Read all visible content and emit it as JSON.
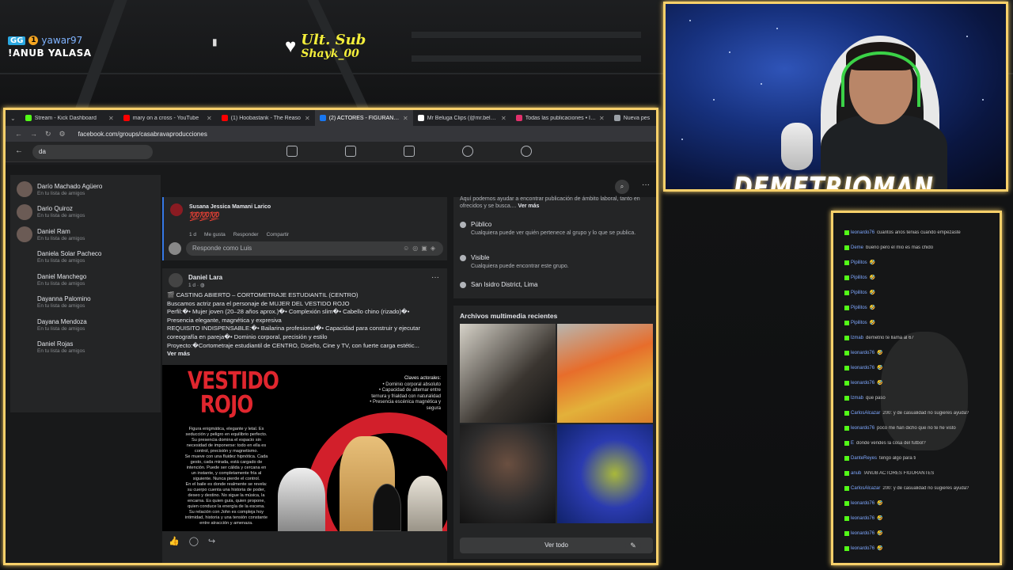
{
  "overlay": {
    "viewer_badge": "GG",
    "viewer_count_badge": "1",
    "viewer_name": "yawar97",
    "command_text": "!ANUB YALASA",
    "sub_label": "Ult. Sub",
    "sub_name": "Shayk_00",
    "streamer_name": "DEMETRIOMAN"
  },
  "browser": {
    "tabs": [
      {
        "label": "Stream - Kick Dashboard",
        "color": "#53fc18",
        "active": false
      },
      {
        "label": "mary on a cross - YouTube",
        "color": "#ff0000",
        "active": false
      },
      {
        "label": "(1) Hoobastank - The Reaso",
        "color": "#ff0000",
        "active": false
      },
      {
        "label": "(2) ACTORES - FIGURANTES - E",
        "color": "#1877f2",
        "active": true
      },
      {
        "label": "Mr Beluga Clips (@mr.beluga.c",
        "color": "#ffffff",
        "active": false
      },
      {
        "label": "Todas las publicaciones • Insta",
        "color": "#e1306c",
        "active": false
      },
      {
        "label": "Nueva pes",
        "color": "#9aa0a6",
        "active": false
      }
    ],
    "url": "facebook.com/groups/casabravaproducciones"
  },
  "search": {
    "query": "da",
    "results": [
      {
        "name": "Darío Machado Agüero",
        "sub": "En tu lista de amigos",
        "has_avatar": true
      },
      {
        "name": "Dario Quiroz",
        "sub": "En tu lista de amigos",
        "has_avatar": true
      },
      {
        "name": "Daniel Ram",
        "sub": "En tu lista de amigos",
        "has_avatar": true
      },
      {
        "name": "Daniela Solar Pacheco",
        "sub": "En tu lista de amigos",
        "has_avatar": false
      },
      {
        "name": "Daniel Manchego",
        "sub": "En tu lista de amigos",
        "has_avatar": false
      },
      {
        "name": "Dayanna Palomino",
        "sub": "En tu lista de amigos",
        "has_avatar": false
      },
      {
        "name": "Dayana Mendoza",
        "sub": "En tu lista de amigos",
        "has_avatar": false
      },
      {
        "name": "Daniel Rojas",
        "sub": "En tu lista de amigos",
        "has_avatar": false
      }
    ]
  },
  "comment": {
    "author": "Susana Jessica Mamani Larico",
    "emoji_text": "💯💯💯",
    "time": "1 d",
    "like": "Me gusta",
    "reply": "Responder",
    "share": "Compartir",
    "reply_placeholder": "Responde como Luis"
  },
  "post": {
    "author": "Daniel Lara",
    "time": "1 d · ",
    "lines": [
      "🎬 CASTING ABIERTO – CORTOMETRAJE ESTUDIANTIL (CENTRO)",
      "Buscamos actriz para el personaje de MUJER DEL VESTIDO ROJO",
      "Perfil:�• Mujer joven (20–28 años aprox.)�• Complexión slim�• Cabello chino (rizado)�•",
      "Presencia elegante, magnética y expresiva",
      "REQUISITO INDISPENSABLE:�• Bailarina profesional�• Capacidad para construir y ejecutar",
      "coreografía en pareja�• Dominio corporal, precisión y estilo",
      "Proyecto:�Cortometraje estudiantil de CENTRO, Diseño, Cine y TV, con fuerte carga estétic..."
    ],
    "see_more": "Ver más",
    "poster_title_1": "VESTIDO",
    "poster_title_2": "ROJO",
    "poster_right_heading": "Claves actorales:",
    "poster_right_lines": [
      "• Dominio corporal absoluto",
      "• Capacidad de alternar entre",
      "ternura y frialdad con naturalidad",
      "• Presencia escénica magnética y",
      "segura"
    ],
    "poster_left_lines": [
      "Figura enigmática, elegante y letal. Es",
      "seducción y peligro en equilibrio perfecto.",
      "Su presencia domina el espacio sin",
      "necesidad de imponerse: todo en ella es",
      "control, precisión y magnetismo.",
      "Se mueve con una fluidez hipnótica. Cada",
      "gesto, cada mirada, está cargado de",
      "intención. Puede ser cálida y cercana en",
      "un instante, y completamente fría al",
      "siguiente. Nunca pierde el control.",
      "En el baile es donde realmente se revela:",
      "su cuerpo cuenta una historia de poder,",
      "deseo y destino. No sigue la música, la",
      "encarna. Es quien guía, quien propone,",
      "quien conduce la energía de la escena.",
      "Su relación con John es compleja hoy",
      "intimidad, historia y una tensión constante",
      "entre atracción y amenaza."
    ]
  },
  "about": {
    "intro": "Aquí podemos ayudar a encontrar publicación de ámbito laboral, tanto en ofrecidos y se busca....",
    "intro_more": "Ver más",
    "public_title": "Público",
    "public_desc": "Cualquiera puede ver quién pertenece al grupo y lo que se publica.",
    "visible_title": "Visible",
    "visible_desc": "Cualquiera puede encontrar este grupo.",
    "location": "San Isidro District, Lima"
  },
  "media": {
    "title": "Archivos multimedia recientes",
    "view_all": "Ver todo"
  },
  "chat": {
    "messages": [
      {
        "user": "leonardo76",
        "msg": "cuantos años tenias cuando empezaste"
      },
      {
        "user": "Deme",
        "msg": "bueno pero el mio es mas chido"
      },
      {
        "user": "Pipilitos",
        "msg": "🤣"
      },
      {
        "user": "Pipilitos",
        "msg": "🤣"
      },
      {
        "user": "Pipilitos",
        "msg": "🤣"
      },
      {
        "user": "Pipilitos",
        "msg": "🤣"
      },
      {
        "user": "Pipilitos",
        "msg": "🤣"
      },
      {
        "user": "lzmab",
        "msg": "demetrio te llama al 67"
      },
      {
        "user": "leonardo76",
        "msg": "🤣"
      },
      {
        "user": "leonardo76",
        "msg": "🤣"
      },
      {
        "user": "leonardo76",
        "msg": "🤣"
      },
      {
        "user": "lzmab",
        "msg": "que paso"
      },
      {
        "user": "CarlosAlcazar",
        "msg": "200: y de casualidad no sugieres ayuda?"
      },
      {
        "user": "leonardo76",
        "msg": "poco me han dicho que no te he visto"
      },
      {
        "user": "E",
        "msg": "donde vendes la cosa del futbol?"
      },
      {
        "user": "DanteReyes",
        "msg": "tengo algo para ti"
      },
      {
        "user": "anub",
        "msg": "!ANUB ACTORES FIGURANTES"
      },
      {
        "user": "CarlosAlcazar",
        "msg": "200: y de casualidad no sugieres ayuda?"
      },
      {
        "user": "leonardo76",
        "msg": "🤣"
      },
      {
        "user": "leonardo76",
        "msg": "🤣"
      },
      {
        "user": "leonardo76",
        "msg": "🤣"
      },
      {
        "user": "leonardo76",
        "msg": "🤣"
      }
    ]
  }
}
